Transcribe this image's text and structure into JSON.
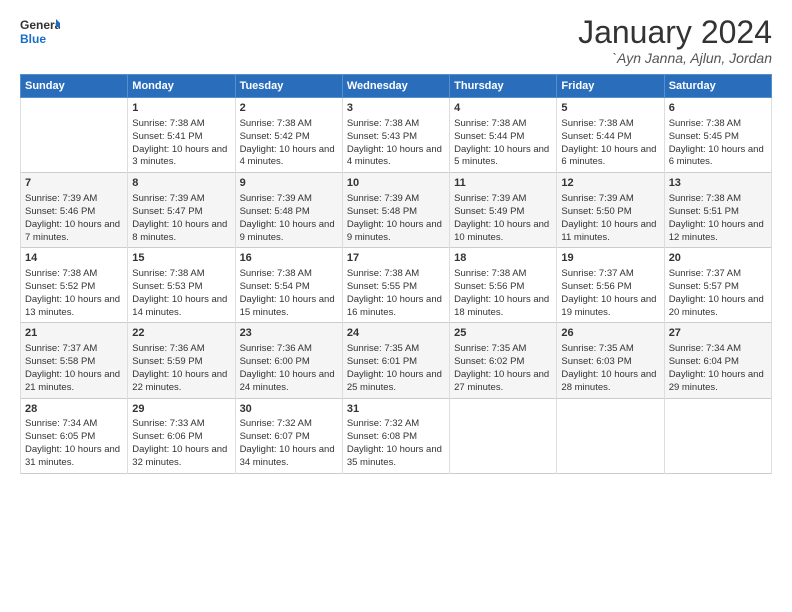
{
  "logo": {
    "line1": "General",
    "line2": "Blue"
  },
  "title": "January 2024",
  "location": "`Ayn Janna, Ajlun, Jordan",
  "header_days": [
    "Sunday",
    "Monday",
    "Tuesday",
    "Wednesday",
    "Thursday",
    "Friday",
    "Saturday"
  ],
  "weeks": [
    [
      {
        "day": "",
        "sunrise": "",
        "sunset": "",
        "daylight": ""
      },
      {
        "day": "1",
        "sunrise": "Sunrise: 7:38 AM",
        "sunset": "Sunset: 5:41 PM",
        "daylight": "Daylight: 10 hours and 3 minutes."
      },
      {
        "day": "2",
        "sunrise": "Sunrise: 7:38 AM",
        "sunset": "Sunset: 5:42 PM",
        "daylight": "Daylight: 10 hours and 4 minutes."
      },
      {
        "day": "3",
        "sunrise": "Sunrise: 7:38 AM",
        "sunset": "Sunset: 5:43 PM",
        "daylight": "Daylight: 10 hours and 4 minutes."
      },
      {
        "day": "4",
        "sunrise": "Sunrise: 7:38 AM",
        "sunset": "Sunset: 5:44 PM",
        "daylight": "Daylight: 10 hours and 5 minutes."
      },
      {
        "day": "5",
        "sunrise": "Sunrise: 7:38 AM",
        "sunset": "Sunset: 5:44 PM",
        "daylight": "Daylight: 10 hours and 6 minutes."
      },
      {
        "day": "6",
        "sunrise": "Sunrise: 7:38 AM",
        "sunset": "Sunset: 5:45 PM",
        "daylight": "Daylight: 10 hours and 6 minutes."
      }
    ],
    [
      {
        "day": "7",
        "sunrise": "Sunrise: 7:39 AM",
        "sunset": "Sunset: 5:46 PM",
        "daylight": "Daylight: 10 hours and 7 minutes."
      },
      {
        "day": "8",
        "sunrise": "Sunrise: 7:39 AM",
        "sunset": "Sunset: 5:47 PM",
        "daylight": "Daylight: 10 hours and 8 minutes."
      },
      {
        "day": "9",
        "sunrise": "Sunrise: 7:39 AM",
        "sunset": "Sunset: 5:48 PM",
        "daylight": "Daylight: 10 hours and 9 minutes."
      },
      {
        "day": "10",
        "sunrise": "Sunrise: 7:39 AM",
        "sunset": "Sunset: 5:48 PM",
        "daylight": "Daylight: 10 hours and 9 minutes."
      },
      {
        "day": "11",
        "sunrise": "Sunrise: 7:39 AM",
        "sunset": "Sunset: 5:49 PM",
        "daylight": "Daylight: 10 hours and 10 minutes."
      },
      {
        "day": "12",
        "sunrise": "Sunrise: 7:39 AM",
        "sunset": "Sunset: 5:50 PM",
        "daylight": "Daylight: 10 hours and 11 minutes."
      },
      {
        "day": "13",
        "sunrise": "Sunrise: 7:38 AM",
        "sunset": "Sunset: 5:51 PM",
        "daylight": "Daylight: 10 hours and 12 minutes."
      }
    ],
    [
      {
        "day": "14",
        "sunrise": "Sunrise: 7:38 AM",
        "sunset": "Sunset: 5:52 PM",
        "daylight": "Daylight: 10 hours and 13 minutes."
      },
      {
        "day": "15",
        "sunrise": "Sunrise: 7:38 AM",
        "sunset": "Sunset: 5:53 PM",
        "daylight": "Daylight: 10 hours and 14 minutes."
      },
      {
        "day": "16",
        "sunrise": "Sunrise: 7:38 AM",
        "sunset": "Sunset: 5:54 PM",
        "daylight": "Daylight: 10 hours and 15 minutes."
      },
      {
        "day": "17",
        "sunrise": "Sunrise: 7:38 AM",
        "sunset": "Sunset: 5:55 PM",
        "daylight": "Daylight: 10 hours and 16 minutes."
      },
      {
        "day": "18",
        "sunrise": "Sunrise: 7:38 AM",
        "sunset": "Sunset: 5:56 PM",
        "daylight": "Daylight: 10 hours and 18 minutes."
      },
      {
        "day": "19",
        "sunrise": "Sunrise: 7:37 AM",
        "sunset": "Sunset: 5:56 PM",
        "daylight": "Daylight: 10 hours and 19 minutes."
      },
      {
        "day": "20",
        "sunrise": "Sunrise: 7:37 AM",
        "sunset": "Sunset: 5:57 PM",
        "daylight": "Daylight: 10 hours and 20 minutes."
      }
    ],
    [
      {
        "day": "21",
        "sunrise": "Sunrise: 7:37 AM",
        "sunset": "Sunset: 5:58 PM",
        "daylight": "Daylight: 10 hours and 21 minutes."
      },
      {
        "day": "22",
        "sunrise": "Sunrise: 7:36 AM",
        "sunset": "Sunset: 5:59 PM",
        "daylight": "Daylight: 10 hours and 22 minutes."
      },
      {
        "day": "23",
        "sunrise": "Sunrise: 7:36 AM",
        "sunset": "Sunset: 6:00 PM",
        "daylight": "Daylight: 10 hours and 24 minutes."
      },
      {
        "day": "24",
        "sunrise": "Sunrise: 7:35 AM",
        "sunset": "Sunset: 6:01 PM",
        "daylight": "Daylight: 10 hours and 25 minutes."
      },
      {
        "day": "25",
        "sunrise": "Sunrise: 7:35 AM",
        "sunset": "Sunset: 6:02 PM",
        "daylight": "Daylight: 10 hours and 27 minutes."
      },
      {
        "day": "26",
        "sunrise": "Sunrise: 7:35 AM",
        "sunset": "Sunset: 6:03 PM",
        "daylight": "Daylight: 10 hours and 28 minutes."
      },
      {
        "day": "27",
        "sunrise": "Sunrise: 7:34 AM",
        "sunset": "Sunset: 6:04 PM",
        "daylight": "Daylight: 10 hours and 29 minutes."
      }
    ],
    [
      {
        "day": "28",
        "sunrise": "Sunrise: 7:34 AM",
        "sunset": "Sunset: 6:05 PM",
        "daylight": "Daylight: 10 hours and 31 minutes."
      },
      {
        "day": "29",
        "sunrise": "Sunrise: 7:33 AM",
        "sunset": "Sunset: 6:06 PM",
        "daylight": "Daylight: 10 hours and 32 minutes."
      },
      {
        "day": "30",
        "sunrise": "Sunrise: 7:32 AM",
        "sunset": "Sunset: 6:07 PM",
        "daylight": "Daylight: 10 hours and 34 minutes."
      },
      {
        "day": "31",
        "sunrise": "Sunrise: 7:32 AM",
        "sunset": "Sunset: 6:08 PM",
        "daylight": "Daylight: 10 hours and 35 minutes."
      },
      {
        "day": "",
        "sunrise": "",
        "sunset": "",
        "daylight": ""
      },
      {
        "day": "",
        "sunrise": "",
        "sunset": "",
        "daylight": ""
      },
      {
        "day": "",
        "sunrise": "",
        "sunset": "",
        "daylight": ""
      }
    ]
  ]
}
